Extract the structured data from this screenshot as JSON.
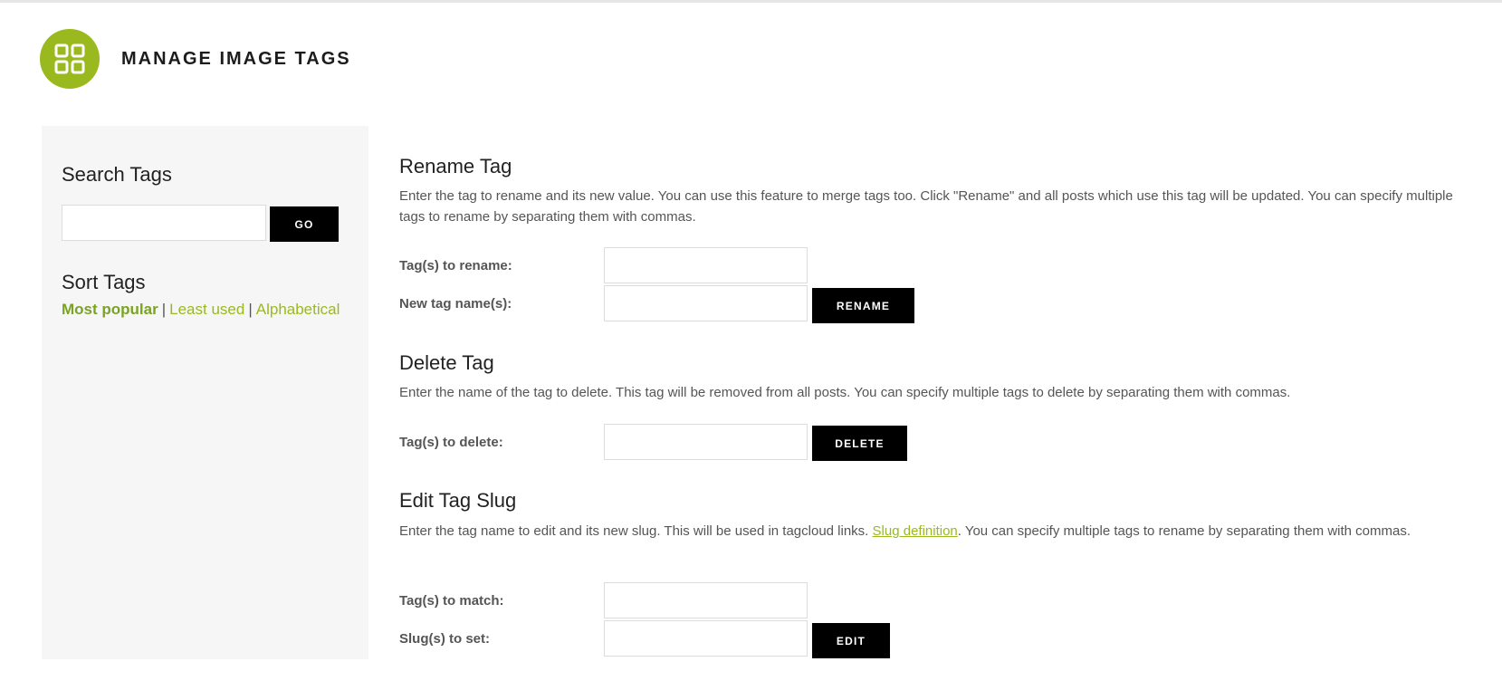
{
  "header": {
    "title": "MANAGE IMAGE TAGS",
    "logo_icon": "grid-four-squares-icon",
    "accent_color": "#9ab91e"
  },
  "sidebar": {
    "search": {
      "heading": "Search Tags",
      "value": "",
      "placeholder": "",
      "button_label": "GO"
    },
    "sort": {
      "heading": "Sort Tags",
      "separator": "|",
      "options": [
        {
          "label": "Most popular",
          "active": true
        },
        {
          "label": "Least used",
          "active": false
        },
        {
          "label": "Alphabetical",
          "active": false
        }
      ]
    }
  },
  "rename": {
    "title": "Rename Tag",
    "description": "Enter the tag to rename and its new value. You can use this feature to merge tags too. Click \"Rename\" and all posts which use this tag will be updated. You can specify multiple tags to rename by separating them with commas.",
    "label_old": "Tag(s) to rename:",
    "label_new": "New tag name(s):",
    "value_old": "",
    "value_new": "",
    "button_label": "RENAME"
  },
  "delete": {
    "title": "Delete Tag",
    "description": "Enter the name of the tag to delete. This tag will be removed from all posts. You can specify multiple tags to delete by separating them with commas.",
    "label": "Tag(s) to delete:",
    "value": "",
    "button_label": "DELETE"
  },
  "slug": {
    "title": "Edit Tag Slug",
    "description_before": "Enter the tag name to edit and its new slug. This will be used in tagcloud links. ",
    "link_text": "Slug definition",
    "description_after": ". You can specify multiple tags to rename by separating them with commas.",
    "label_match": "Tag(s) to match:",
    "label_slug": "Slug(s) to set:",
    "value_match": "",
    "value_slug": "",
    "button_label": "EDIT"
  }
}
